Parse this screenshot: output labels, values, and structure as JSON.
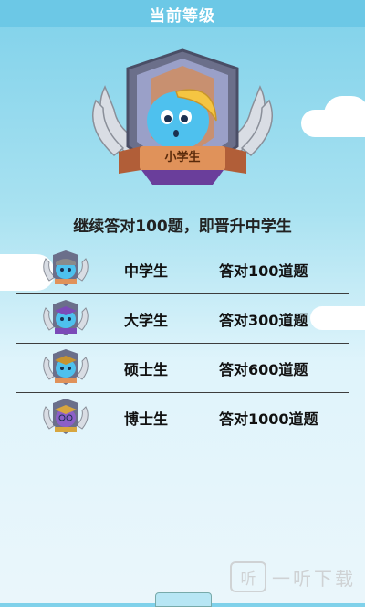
{
  "header": {
    "title": "当前等级"
  },
  "current": {
    "badge_label": "小学生",
    "progress_text": "继续答对100题，即晋升中学生"
  },
  "levels": [
    {
      "name": "中学生",
      "requirement": "答对100道题"
    },
    {
      "name": "大学生",
      "requirement": "答对300道题"
    },
    {
      "name": "硕士生",
      "requirement": "答对600道题"
    },
    {
      "name": "博士生",
      "requirement": "答对1000道题"
    }
  ],
  "watermark": {
    "logo": "听",
    "text": "一听下载"
  },
  "colors": {
    "header_bg": "#6cc8e6",
    "badge_blob": "#4ec1ee",
    "level_hats": [
      "#8a8a8a",
      "#7b4ab8",
      "#c79330",
      "#d7a63f"
    ]
  }
}
